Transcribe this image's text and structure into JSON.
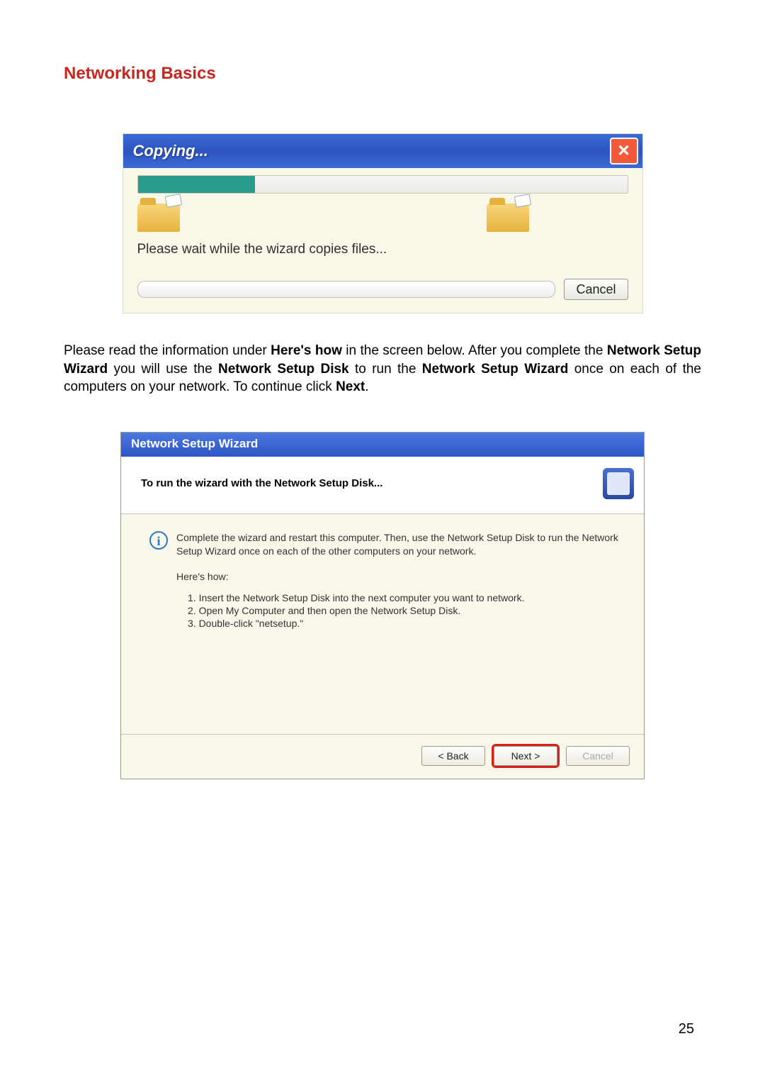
{
  "heading": "Networking Basics",
  "copy_dialog": {
    "title": "Copying...",
    "message": "Please wait while the wizard copies files...",
    "cancel": "Cancel",
    "progress_percent": 24
  },
  "instruction": {
    "pre": "Please read the information under ",
    "b1": "Here's how",
    "mid1": " in the screen below.  After you complete the ",
    "b2": "Network Setup Wizard",
    "mid2": " you will use the ",
    "b3": "Network Setup Disk",
    "mid3": " to run the ",
    "b4": "Network Setup Wizard",
    "mid4": " once on each of the computers on your network.  To continue click ",
    "b5": "Next",
    "post": "."
  },
  "wizard": {
    "window_title": "Network Setup Wizard",
    "header": "To run the wizard with the Network Setup Disk...",
    "info_text": "Complete the wizard and restart this computer. Then, use the Network Setup Disk to run the Network Setup Wizard once on each of the other computers on your network.",
    "heres_how": "Here's how:",
    "steps": [
      "1.  Insert the Network Setup Disk into the next computer you want to network.",
      "2.  Open My Computer and then open the Network Setup Disk.",
      "3.  Double-click \"netsetup.\""
    ],
    "back": "< Back",
    "next": "Next >",
    "cancel": "Cancel"
  },
  "page_number": "25"
}
